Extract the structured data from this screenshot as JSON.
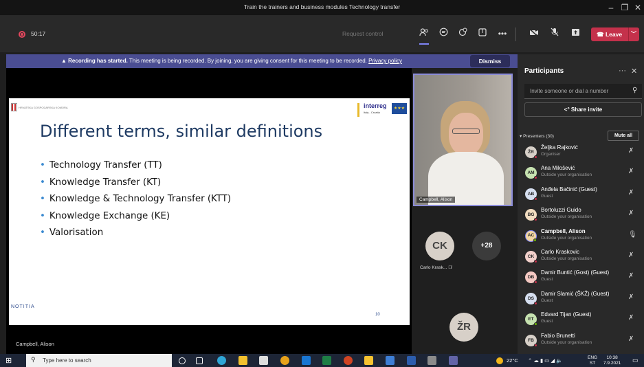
{
  "window": {
    "title": "Train the trainers and business modules Technology transfer",
    "minimize": "–",
    "maximize": "❐",
    "close": "✕"
  },
  "toolbar": {
    "timer": "50:17",
    "request_control": "Request control",
    "leave_label": "Leave",
    "icons": [
      "participants-icon",
      "chat-icon",
      "reactions-icon",
      "rooms-icon",
      "more-icon",
      "camera-off-icon",
      "mic-off-icon",
      "share-icon"
    ]
  },
  "banner": {
    "bold": "Recording has started.",
    "text": " This meeting is being recorded. By joining, you are giving consent for this meeting to be recorded. ",
    "link": "Privacy policy",
    "dismiss": "Dismiss"
  },
  "slide": {
    "org": "HRVATSKA GOSPODARSKA KOMORA",
    "interreg": "interreg",
    "interreg_sub": "Italy - Croatia",
    "title": "Different terms, similar definitions",
    "bullets": [
      "Technology Transfer (TT)",
      "Knowledge Transfer (KT)",
      "Knowledge & Technology Transfer (KTT)",
      "Knowledge Exchange (KE)",
      "Valorisation"
    ],
    "footer": "NOTITIA",
    "page": "10"
  },
  "stage": {
    "presenter_name": "Campbell, Alison"
  },
  "video": {
    "tile_name": "Campbell, Alison",
    "ck_initials": "CK",
    "ck_name": "Carlo Krask...",
    "more": "+28",
    "zr_initials": "ŽR"
  },
  "panel": {
    "title": "Participants",
    "invite_placeholder": "Invite someone or dial a number",
    "share_invite": "Share invite",
    "presenters_label": "Presenters (30)",
    "mute_all": "Mute all",
    "participants": [
      {
        "initials": "ŽR",
        "name": "Željka Rajković",
        "sub": "Organiser",
        "color": "#d7d0c8",
        "status": "red",
        "bold": false,
        "speaking": false
      },
      {
        "initials": "AM",
        "name": "Ana Milošević",
        "sub": "Outside your organisation",
        "color": "#c6e2b0",
        "status": "red",
        "bold": false,
        "speaking": false
      },
      {
        "initials": "AB",
        "name": "Anđela Bačinić (Guest)",
        "sub": "Guest",
        "color": "#d6dff0",
        "status": "red",
        "bold": false,
        "speaking": false
      },
      {
        "initials": "BG",
        "name": "Bortoluzzi Guido",
        "sub": "Outside your organisation",
        "color": "#f1dcc0",
        "status": "red",
        "bold": false,
        "speaking": false
      },
      {
        "initials": "AC",
        "name": "Campbell, Alison",
        "sub": "Outside your organisation",
        "color": "#f2d6a2",
        "status": "green",
        "bold": true,
        "speaking": true
      },
      {
        "initials": "CK",
        "name": "Carlo Kraskovic",
        "sub": "Outside your organisation",
        "color": "#f2d0cb",
        "status": "red",
        "bold": false,
        "speaking": false
      },
      {
        "initials": "DB",
        "name": "Damir Buntić (Gost) (Guest)",
        "sub": "Guest",
        "color": "#f5c9c3",
        "status": "red",
        "bold": false,
        "speaking": false
      },
      {
        "initials": "DS",
        "name": "Damir Slamić (ŠKŽ) (Guest)",
        "sub": "Guest",
        "color": "#d6dff0",
        "status": "red",
        "bold": false,
        "speaking": false
      },
      {
        "initials": "ET",
        "name": "Edvard Tijan (Guest)",
        "sub": "Guest",
        "color": "#c6e2b0",
        "status": "green",
        "bold": false,
        "speaking": false
      },
      {
        "initials": "FB",
        "name": "Fabio Brunetti",
        "sub": "Outside your organisation",
        "color": "#d7d0c8",
        "status": "red",
        "bold": false,
        "speaking": false
      }
    ]
  },
  "taskbar": {
    "search_placeholder": "Type here to search",
    "temperature": "22°C",
    "language": "ENG",
    "lang_sub": "ST",
    "time": "10:38",
    "date": "7.9.2021"
  }
}
